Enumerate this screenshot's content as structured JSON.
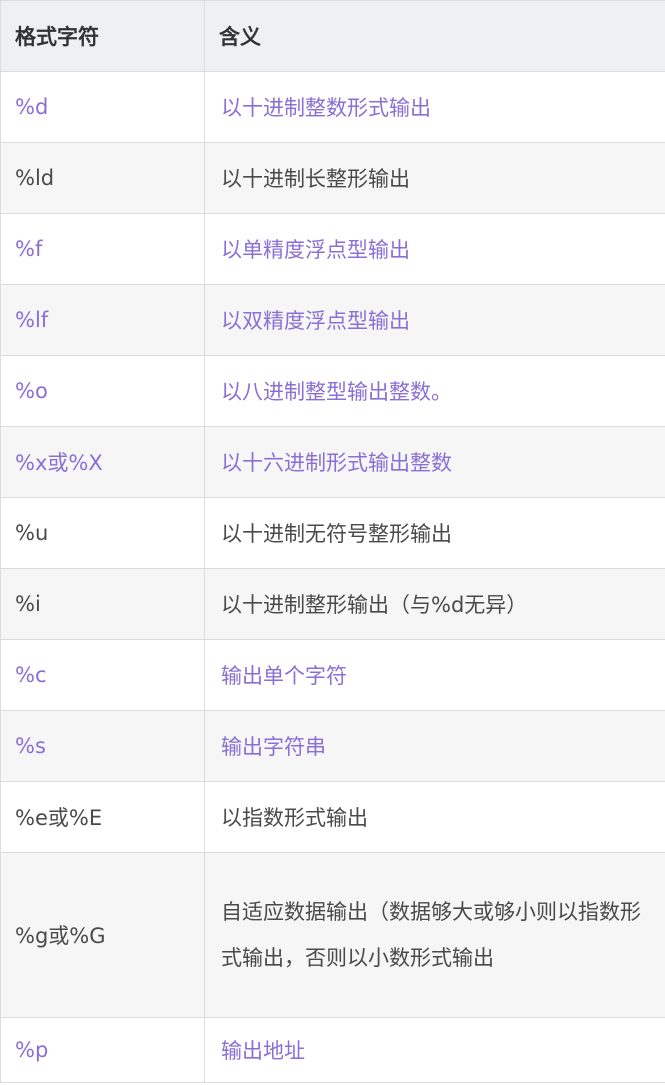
{
  "table": {
    "headers": [
      "格式字符",
      "含义"
    ],
    "rows": [
      {
        "format": "%d",
        "meaning": "以十进制整数形式输出"
      },
      {
        "format": "%ld",
        "meaning": "以十进制长整形输出"
      },
      {
        "format": "%f",
        "meaning": "以单精度浮点型输出"
      },
      {
        "format": "%lf",
        "meaning": "以双精度浮点型输出"
      },
      {
        "format": "%o",
        "meaning": "以八进制整型输出整数。"
      },
      {
        "format": "%x或%X",
        "meaning": "以十六进制形式输出整数"
      },
      {
        "format": "%u",
        "meaning": "以十进制无符号整形输出"
      },
      {
        "format": "%i",
        "meaning": "以十进制整形输出（与%d无异）"
      },
      {
        "format": "%c",
        "meaning": "输出单个字符"
      },
      {
        "format": "%s",
        "meaning": "输出字符串"
      },
      {
        "format": "%e或%E",
        "meaning": "以指数形式输出"
      },
      {
        "format": "%g或%G",
        "meaning": "自适应数据输出（数据够大或够小则以指数形式输出，否则以小数形式输出"
      },
      {
        "format": "%p",
        "meaning": "输出地址"
      }
    ]
  },
  "colors": {
    "link_text": "#8a6fd6",
    "plain_text": "#4a4a4a",
    "header_bg": "#eef0f2",
    "stripe_bg": "#f6f6f6",
    "border": "#dcdcdc"
  }
}
